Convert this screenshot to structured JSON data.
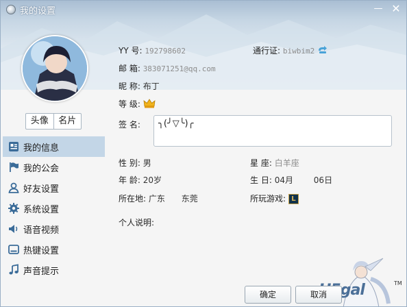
{
  "window": {
    "title": "我的设置",
    "min_label": "—",
    "close_label": "✕"
  },
  "avatar_tabs": [
    "头像",
    "名片"
  ],
  "sidebar": {
    "items": [
      {
        "label": "我的信息",
        "icon": "profile-card-icon",
        "active": true
      },
      {
        "label": "我的公会",
        "icon": "flag-icon",
        "active": false
      },
      {
        "label": "好友设置",
        "icon": "user-icon",
        "active": false
      },
      {
        "label": "系统设置",
        "icon": "gear-icon",
        "active": false
      },
      {
        "label": "语音视频",
        "icon": "speaker-icon",
        "active": false
      },
      {
        "label": "热键设置",
        "icon": "keyboard-icon",
        "active": false
      },
      {
        "label": "声音提示",
        "icon": "music-note-icon",
        "active": false
      }
    ]
  },
  "profile": {
    "yy_label": "YY 号:",
    "yy_value": "192798602",
    "pass_label": "通行证:",
    "pass_value": "biwbim2",
    "email_label": "邮 箱:",
    "email_value": "383071251@qq.com",
    "nick_label": "昵 称:",
    "nick_value": "布丁",
    "level_label": "等 级:",
    "sign_label": "签 名:",
    "sign_value": "╮(╯▽╰)╭",
    "gender_label": "性 别:",
    "gender_value": "男",
    "zodiac_label": "星 座:",
    "zodiac_value": "白羊座",
    "age_label": "年 龄:",
    "age_value": "20岁",
    "birthday_label": "生 日:",
    "birth_month": "04月",
    "birth_day": "06日",
    "location_label": "所在地:",
    "province": "广东",
    "city": "东莞",
    "games_label": "所玩游戏:",
    "game_icon_text": "L",
    "bio_label": "个人说明:"
  },
  "buttons": {
    "ok": "确定",
    "cancel": "取消"
  },
  "branding": {
    "logo_text": "H5gal",
    "tm": "TM"
  },
  "colors": {
    "active_item": "#c3d6e7",
    "gray_text": "#8c8c8c"
  }
}
